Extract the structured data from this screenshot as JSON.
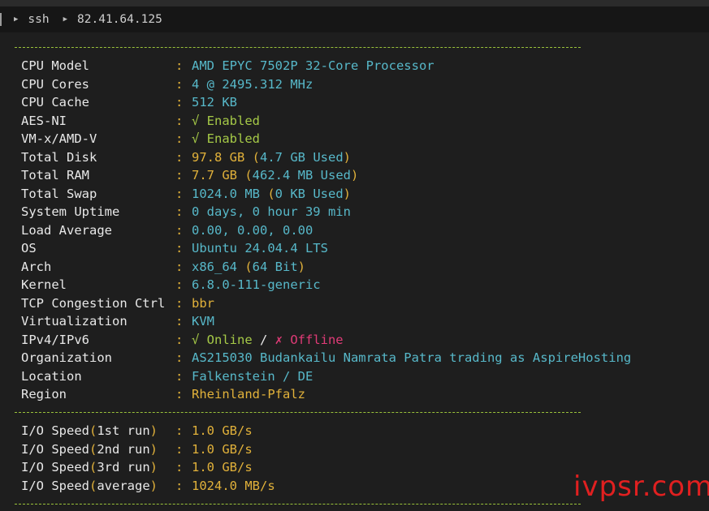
{
  "titlebar": {
    "breadcrumb_1": "ssh",
    "breadcrumb_2": "82.41.64.125"
  },
  "info": {
    "cpu_model": {
      "label": "CPU Model",
      "value": "AMD EPYC 7502P 32-Core Processor"
    },
    "cpu_cores": {
      "label": "CPU Cores",
      "value": "4 @ 2495.312 MHz"
    },
    "cpu_cache": {
      "label": "CPU Cache",
      "value": "512 KB"
    },
    "aes_ni": {
      "label": "AES-NI",
      "value": "√ Enabled"
    },
    "vmx": {
      "label": "VM-x/AMD-V",
      "value": "√ Enabled"
    },
    "total_disk": {
      "label": "Total Disk",
      "value": "97.8 GB",
      "open": " (",
      "used": "4.7 GB Used",
      "close": ")"
    },
    "total_ram": {
      "label": "Total RAM",
      "value": "7.7 GB",
      "open": " (",
      "used": "462.4 MB Used",
      "close": ")"
    },
    "total_swap": {
      "label": "Total Swap",
      "value": "1024.0 MB",
      "open": " (",
      "used": "0 KB Used",
      "close": ")"
    },
    "uptime": {
      "label": "System Uptime",
      "value": "0 days, 0 hour 39 min"
    },
    "load": {
      "label": "Load Average",
      "value": "0.00, 0.00, 0.00"
    },
    "os": {
      "label": "OS",
      "value": "Ubuntu 24.04.4 LTS"
    },
    "arch": {
      "label": "Arch",
      "value": "x86_64",
      "open": " (",
      "extra": "64 Bit",
      "close": ")"
    },
    "kernel": {
      "label": "Kernel",
      "value": "6.8.0-111-generic"
    },
    "tcp": {
      "label": "TCP Congestion Ctrl",
      "value": "bbr"
    },
    "virt": {
      "label": "Virtualization",
      "value": "KVM"
    },
    "ip": {
      "label": "IPv4/IPv6",
      "online": "√ Online",
      "slash": " / ",
      "offline": "✗ Offline"
    },
    "org": {
      "label": "Organization",
      "value": "AS215030 Budankailu Namrata Patra trading as AspireHosting"
    },
    "location": {
      "label": "Location",
      "value": "Falkenstein / DE"
    },
    "region": {
      "label": "Region",
      "value": "Rheinland-Pfalz"
    }
  },
  "io": {
    "run1": {
      "prefix": "I/O Speed",
      "open": "(",
      "run": "1st run",
      "close": ")",
      "value": "1.0 GB/s"
    },
    "run2": {
      "prefix": "I/O Speed",
      "open": "(",
      "run": "2nd run",
      "close": ")",
      "value": "1.0 GB/s"
    },
    "run3": {
      "prefix": "I/O Speed",
      "open": "(",
      "run": "3rd run",
      "close": ")",
      "value": "1.0 GB/s"
    },
    "avg": {
      "prefix": "I/O Speed",
      "open": "(",
      "run": "average",
      "close": ")",
      "value": "1024.0 MB/s"
    }
  },
  "watermark": "ivpsr.com"
}
